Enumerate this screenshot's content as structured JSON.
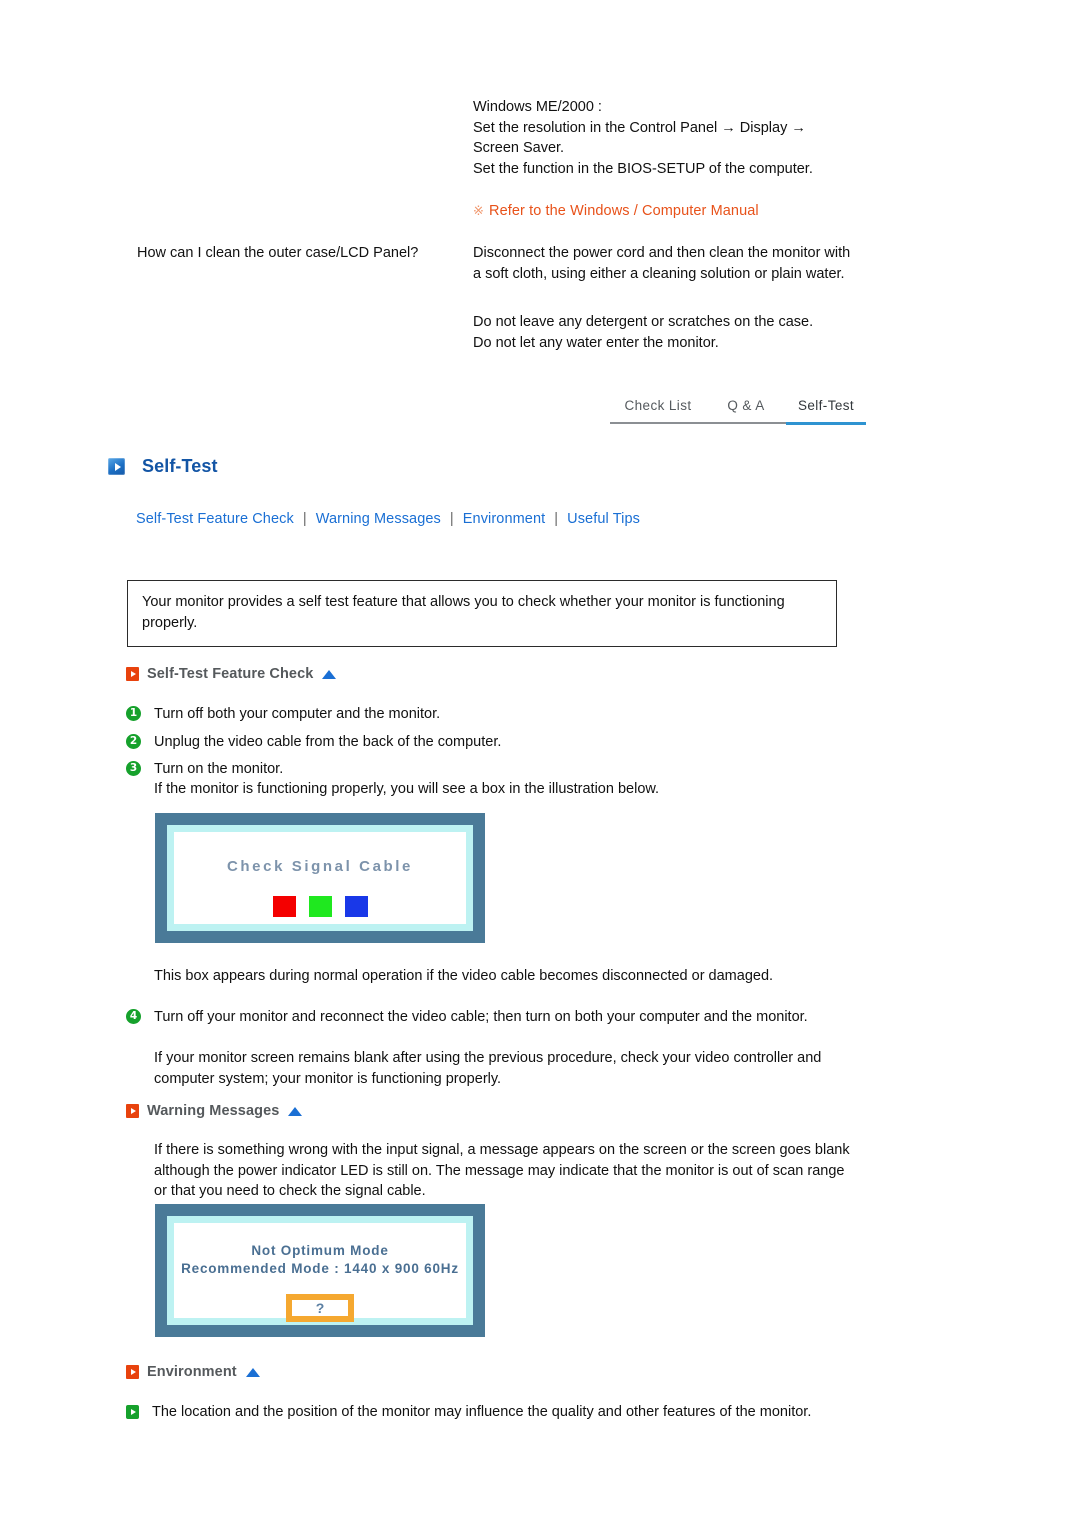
{
  "faq": {
    "answer_top": "Windows ME/2000 :\nSet the resolution in the Control Panel → Display → Screen Saver.\nSet the function in the BIOS-SETUP of the computer.",
    "refer_mark": "※",
    "refer_note": "Refer to the Windows / Computer Manual",
    "question_2": "How can I clean the outer case/LCD Panel?",
    "answer_2a": "Disconnect the power cord and then clean the monitor with a soft cloth, using either a cleaning solution or plain water.",
    "answer_2b": "Do not leave any detergent or scratches on the case.\nDo not let any water enter the monitor."
  },
  "tabs": [
    {
      "label": "Check List",
      "active": false
    },
    {
      "label": "Q & A",
      "active": false
    },
    {
      "label": "Self-Test",
      "active": true
    }
  ],
  "heading": {
    "icon": "blue-play-icon",
    "title": "Self-Test"
  },
  "subnav": {
    "separator": "|",
    "items": [
      {
        "label": "Self-Test Feature Check"
      },
      {
        "label": "Warning Messages"
      },
      {
        "label": "Environment"
      },
      {
        "label": "Useful Tips"
      }
    ]
  },
  "intro": {
    "text": "Your monitor provides a self test feature that allows you to check whether your monitor is functioning properly."
  },
  "sections": {
    "self_test_feature_check": {
      "title": "Self-Test Feature Check",
      "bullet_icon": "orange-play-icon",
      "top_icon": "up-triangle-icon",
      "steps": [
        {
          "num": "1",
          "text": "Turn off both your computer and the monitor."
        },
        {
          "num": "2",
          "text": "Unplug the video cable from the back of the computer."
        },
        {
          "num": "3",
          "text": "Turn on the monitor."
        }
      ],
      "note_after_steps": "If the monitor is functioning properly, you will see a box in the illustration below.",
      "note_after_box": "This box appears during normal operation if the video cable becomes disconnected or damaged.",
      "step4": {
        "num": "4",
        "text": "Turn off your monitor and reconnect the video cable; then turn on both your computer and the monitor."
      },
      "note_after_step4": "If your monitor screen remains blank after using the previous procedure, check your video controller and computer system; your monitor is functioning properly."
    },
    "warning_messages": {
      "title": "Warning Messages",
      "bullet_icon": "orange-play-icon",
      "top_icon": "up-triangle-icon",
      "text": "If there is something wrong with the input signal, a message appears on the screen or the screen goes blank although the power indicator LED is still on. The message may indicate that the monitor is out of scan range or that you need to check the signal cable."
    },
    "environment": {
      "title": "Environment",
      "bullet_icon": "orange-play-icon",
      "top_icon": "up-triangle-icon",
      "bullets": [
        {
          "text": "The location and the position of the monitor may influence the quality and other features of the monitor."
        }
      ]
    }
  },
  "illustration_self_test": {
    "name": "check-signal-cable-screen",
    "osd_text": "Check Signal Cable",
    "color_blocks": [
      {
        "name": "red-block",
        "color": "#f40000"
      },
      {
        "name": "green-block",
        "color": "#1fe81f"
      },
      {
        "name": "blue-block",
        "color": "#1938e8"
      }
    ],
    "bezel_color": "#4a7a98",
    "inner_border_color": "#bdf2f2"
  },
  "illustration_warning": {
    "name": "not-optimum-mode-screen",
    "line1": "Not Optimum Mode",
    "line2": "Recommended Mode : 1440 x 900  60Hz",
    "question_mark": "?",
    "accent_color": "#f5a830",
    "bezel_color": "#4a7a98",
    "inner_border_color": "#bdf2f2"
  }
}
